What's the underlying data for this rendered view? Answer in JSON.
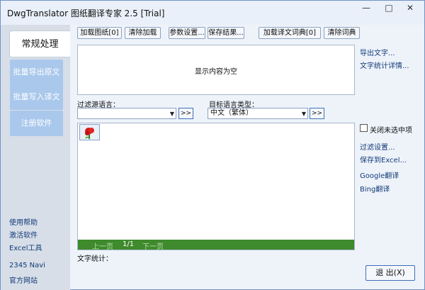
{
  "window": {
    "title": "DwgTranslator 图纸翻译专家 2.5 [Trial]",
    "controls": {
      "minimize": "—",
      "maximize": "□",
      "close": "✕"
    }
  },
  "sidebar": {
    "tabs": [
      {
        "label": "常规处理",
        "active": true
      },
      {
        "label": "批量导出原文",
        "active": false
      },
      {
        "label": "批量写入译文",
        "active": false
      },
      {
        "label": "注册软件",
        "active": false
      }
    ],
    "links": [
      "使用帮助",
      "激活软件",
      "Excel工具",
      "2345 Navi",
      "官方网站"
    ]
  },
  "toolbar": {
    "buttons": [
      "加载图纸[0]",
      "清除加载",
      "参数设置...",
      "保存结果...",
      "加载译文词典[0]",
      "清除词典"
    ]
  },
  "display": {
    "empty_text": "显示内容为空"
  },
  "filter": {
    "source_label": "过滤源语言：",
    "source_value": "",
    "target_label": "目标语言类型：",
    "target_value": "中文（繁体）",
    "arrow_label": ">>"
  },
  "pager": {
    "prev": "上一页",
    "page": "1/1",
    "next": "下一页"
  },
  "stats_label": "文字统计：",
  "right_panel": {
    "top_links": [
      "导出文字...",
      "文字统计详情..."
    ],
    "close_unselected": {
      "label": "关闭未选中项",
      "checked": false
    },
    "bottom_links": [
      "过滤设置...",
      "保存到Excel...",
      "Google翻译",
      "Bing翻译"
    ]
  },
  "exit": {
    "label": "退 出(X)"
  },
  "colors": {
    "accent": "#3e8a2c",
    "sidebar_tab": "#a9c8ec",
    "link": "#123b77",
    "window_bg": "#eef3fa"
  }
}
